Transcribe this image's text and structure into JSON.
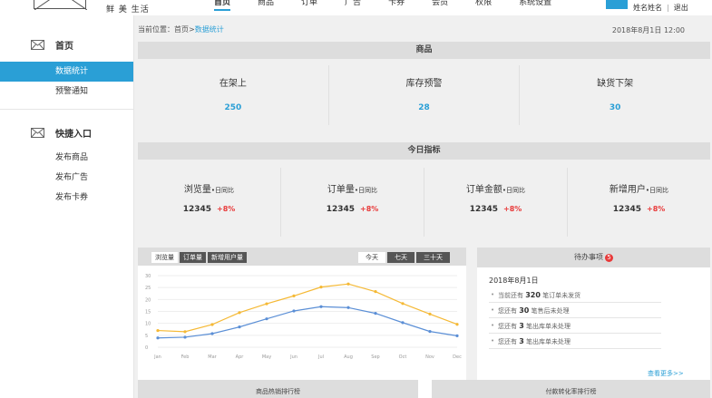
{
  "header": {
    "brand": "鲜 美 生活",
    "nav": [
      "首页",
      "商品",
      "订单",
      "广告",
      "卡券",
      "会员",
      "权限",
      "系统设置"
    ],
    "user_name": "姓名姓名",
    "logout": "退出"
  },
  "sidebar": {
    "groups": [
      {
        "title": "首页",
        "items": [
          "数据统计",
          "预警通知"
        ]
      },
      {
        "title": "快捷入口",
        "items": [
          "发布商品",
          "发布广告",
          "发布卡券"
        ]
      }
    ]
  },
  "breadcrumb": {
    "prefix": "当前位置：首页>",
    "current": "数据统计"
  },
  "datetime": "2018年8月1日 12:00",
  "goods": {
    "title": "商品",
    "cells": [
      {
        "label": "在架上",
        "value": "250"
      },
      {
        "label": "库存预警",
        "value": "28"
      },
      {
        "label": "缺货下架",
        "value": "30"
      }
    ]
  },
  "today": {
    "title": "今日指标",
    "suffix": "•日同比",
    "cells": [
      {
        "label": "浏览量",
        "value": "12345",
        "change": "+8%"
      },
      {
        "label": "订单量",
        "value": "12345",
        "change": "+8%"
      },
      {
        "label": "订单金额",
        "value": "12345",
        "change": "+8%"
      },
      {
        "label": "新增用户",
        "value": "12345",
        "change": "+8%"
      }
    ]
  },
  "chart_tabs": {
    "metrics": [
      "浏览量",
      "订单量",
      "新增用户量"
    ],
    "ranges": [
      "今天",
      "七天",
      "三十天"
    ]
  },
  "chart_data": {
    "type": "line",
    "categories": [
      "Jan",
      "Feb",
      "Mar",
      "Apr",
      "May",
      "Jun",
      "Jul",
      "Aug",
      "Sep",
      "Oct",
      "Nov",
      "Dec"
    ],
    "series": [
      {
        "values": [
          7,
          6.5,
          9.5,
          14.5,
          18.2,
          21.5,
          25.2,
          26.5,
          23.3,
          18.3,
          13.9,
          9.6
        ],
        "color": "#f5b935"
      },
      {
        "values": [
          3.9,
          4.2,
          5.7,
          8.5,
          11.9,
          15.2,
          17,
          16.6,
          14.2,
          10.3,
          6.6,
          4.8
        ],
        "color": "#5b8fd6"
      }
    ],
    "yticks": [
      0,
      5,
      10,
      15,
      20,
      25,
      30
    ],
    "ylim": [
      0,
      30
    ],
    "grid": true
  },
  "todo": {
    "title": "待办事项",
    "count": "5",
    "date": "2018年8月1日",
    "items": [
      {
        "pre": "当前还有",
        "num": "320",
        "post": "笔订单未发货"
      },
      {
        "pre": "您还有",
        "num": "30",
        "post": "笔售后未处理"
      },
      {
        "pre": "您还有",
        "num": "3",
        "post": "笔出库单未处理"
      },
      {
        "pre": "您还有",
        "num": "3",
        "post": "笔出库单未处理"
      }
    ],
    "more": "查看更多>>"
  },
  "bottom": {
    "left": "商品热销排行榜",
    "right": "付款转化率排行榜"
  }
}
